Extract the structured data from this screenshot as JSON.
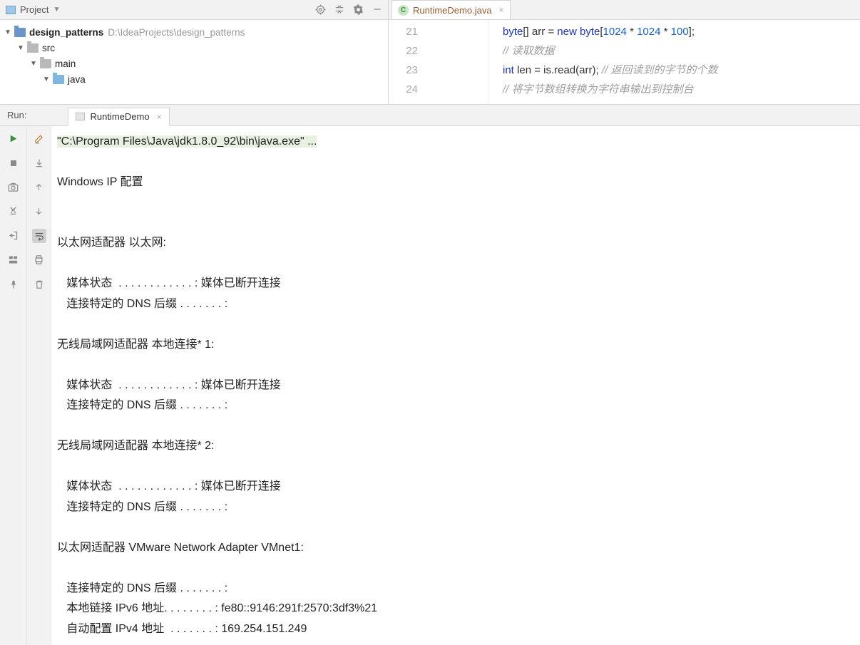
{
  "project_header": {
    "label": "Project"
  },
  "tree": {
    "root": {
      "name": "design_patterns",
      "path": "D:\\IdeaProjects\\design_patterns"
    },
    "n1": "src",
    "n2": "main",
    "n3": "java"
  },
  "editor_tab": {
    "name": "RuntimeDemo.java"
  },
  "gutter": {
    "l1": "21",
    "l2": "22",
    "l3": "23",
    "l4": "24"
  },
  "code": {
    "l1a": "byte",
    "l1b": "[] arr = ",
    "l1c": "new ",
    "l1d": "byte",
    "l1e": "[",
    "l1f": "1024 ",
    "l1g": "* ",
    "l1h": "1024 ",
    "l1i": "* ",
    "l1j": "100",
    "l1k": "];",
    "l2a": "// 读取数据",
    "l3a": "int ",
    "l3b": "len = is.read(arr); ",
    "l3c": "// 返回读到的字节的个数",
    "l4a": "// 将字节数组转换为字符串输出到控制台"
  },
  "run": {
    "label": "Run:",
    "tab": "RuntimeDemo"
  },
  "console": {
    "cmd": "\"C:\\Program Files\\Java\\jdk1.8.0_92\\bin\\java.exe\" ...",
    "l1": "Windows IP 配置",
    "l2": "",
    "l3": "",
    "l4": "以太网适配器 以太网:",
    "l5": "",
    "l6": "   媒体状态  . . . . . . . . . . . . : 媒体已断开连接",
    "l7": "   连接特定的 DNS 后缀 . . . . . . . :",
    "l8": "",
    "l9": "无线局域网适配器 本地连接* 1:",
    "l10": "",
    "l11": "   媒体状态  . . . . . . . . . . . . : 媒体已断开连接",
    "l12": "   连接特定的 DNS 后缀 . . . . . . . :",
    "l13": "",
    "l14": "无线局域网适配器 本地连接* 2:",
    "l15": "",
    "l16": "   媒体状态  . . . . . . . . . . . . : 媒体已断开连接",
    "l17": "   连接特定的 DNS 后缀 . . . . . . . :",
    "l18": "",
    "l19": "以太网适配器 VMware Network Adapter VMnet1:",
    "l20": "",
    "l21": "   连接特定的 DNS 后缀 . . . . . . . :",
    "l22": "   本地链接 IPv6 地址. . . . . . . . : fe80::9146:291f:2570:3df3%21",
    "l23": "   自动配置 IPv4 地址  . . . . . . . : 169.254.151.249"
  }
}
